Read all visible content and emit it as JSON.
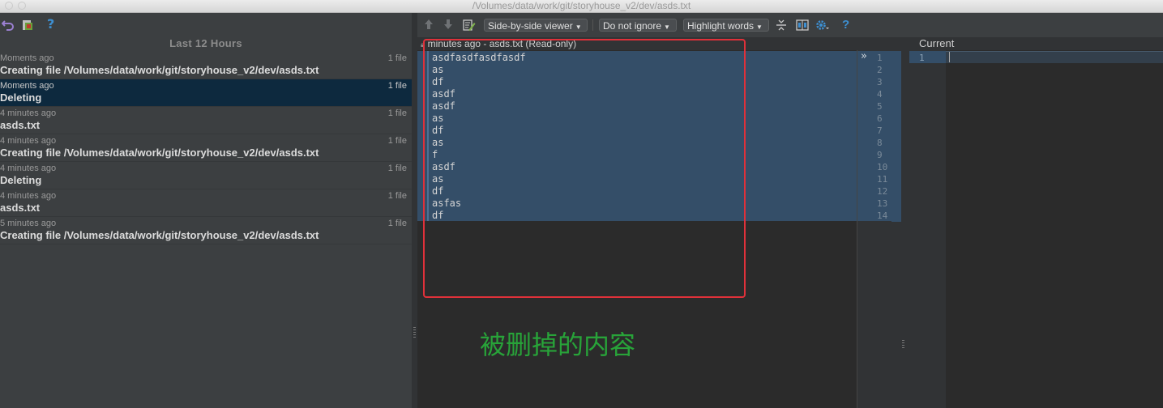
{
  "window": {
    "title": "/Volumes/data/work/git/storyhouse_v2/dev/asds.txt"
  },
  "left_toolbar": {
    "revert_icon": "undo-arrow-icon",
    "create_patch_icon": "patch-icon",
    "help_label": "?"
  },
  "history": {
    "header": "Last 12 Hours",
    "items": [
      {
        "time": "Moments ago",
        "count": "1 file",
        "description": "Creating file /Volumes/data/work/git/storyhouse_v2/dev/asds.txt",
        "selected": false
      },
      {
        "time": "Moments ago",
        "count": "1 file",
        "description": "Deleting",
        "selected": true
      },
      {
        "time": "4 minutes ago",
        "count": "1 file",
        "description": "asds.txt",
        "selected": false
      },
      {
        "time": "4 minutes ago",
        "count": "1 file",
        "description": "Creating file /Volumes/data/work/git/storyhouse_v2/dev/asds.txt",
        "selected": false
      },
      {
        "time": "4 minutes ago",
        "count": "1 file",
        "description": "Deleting",
        "selected": false
      },
      {
        "time": "4 minutes ago",
        "count": "1 file",
        "description": "asds.txt",
        "selected": false
      },
      {
        "time": "5 minutes ago",
        "count": "1 file",
        "description": "Creating file /Volumes/data/work/git/storyhouse_v2/dev/asds.txt",
        "selected": false
      }
    ]
  },
  "diff_toolbar": {
    "prev_label": "🡑",
    "next_label": "🡓",
    "viewer_mode": "Side-by-side viewer",
    "whitespace_mode": "Do not ignore",
    "highlight_mode": "Highlight words",
    "help_label": "?"
  },
  "diff": {
    "left_title": "minutes ago - asds.txt (Read-only)",
    "right_title": "Current",
    "left_lines": [
      "asdfasdfasdfasdf",
      "as",
      "df",
      "asdf",
      "asdf",
      "as",
      "df",
      "as",
      "f",
      "asdf",
      "as",
      "df",
      "asfas",
      "df"
    ],
    "left_line_numbers": [
      "1",
      "2",
      "3",
      "4",
      "5",
      "6",
      "7",
      "8",
      "9",
      "10",
      "11",
      "12",
      "13",
      "14"
    ],
    "right_line_numbers": [
      "1"
    ],
    "apply_chevron": "»",
    "deleted_color": "#344e68"
  },
  "annotation": {
    "text": "被删掉的内容",
    "box_color": "#e0313a",
    "text_color": "#28a339"
  }
}
